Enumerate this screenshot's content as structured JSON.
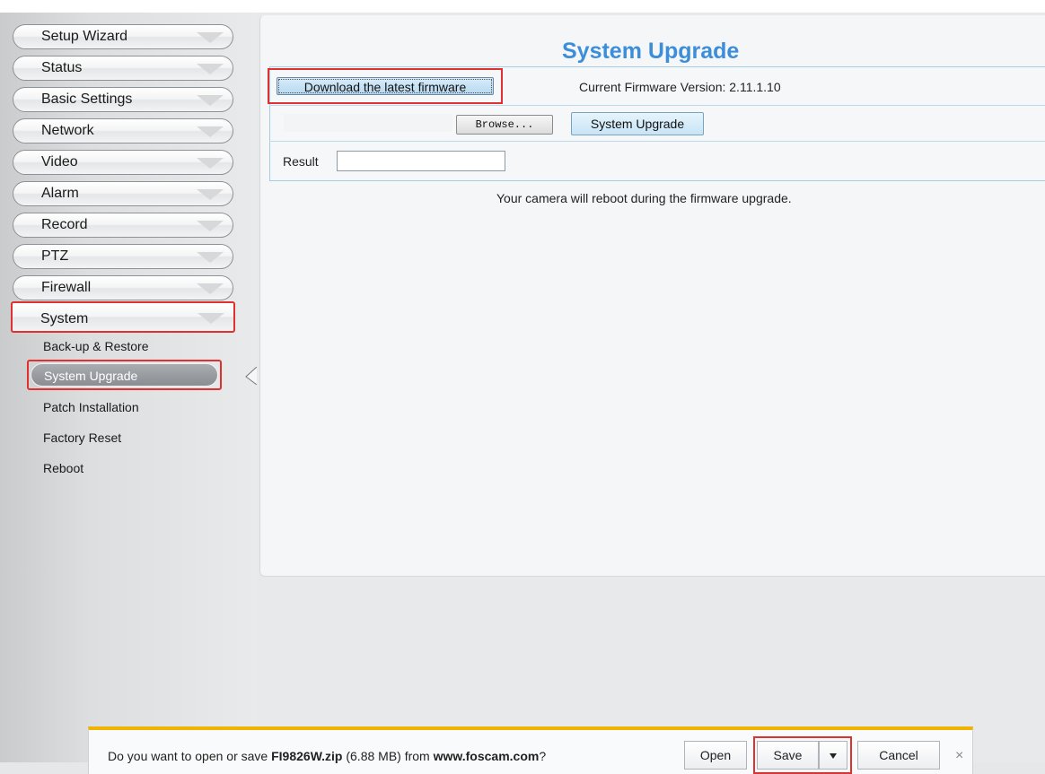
{
  "sidebar": {
    "items": [
      {
        "label": "Setup Wizard"
      },
      {
        "label": "Status"
      },
      {
        "label": "Basic Settings"
      },
      {
        "label": "Network"
      },
      {
        "label": "Video"
      },
      {
        "label": "Alarm"
      },
      {
        "label": "Record"
      },
      {
        "label": "PTZ"
      },
      {
        "label": "Firewall"
      },
      {
        "label": "System"
      }
    ],
    "sub_items": [
      {
        "label": "Back-up & Restore"
      },
      {
        "label": "System Upgrade"
      },
      {
        "label": "Patch Installation"
      },
      {
        "label": "Factory Reset"
      },
      {
        "label": "Reboot"
      }
    ]
  },
  "main": {
    "title": "System Upgrade",
    "download_button": "Download the latest firmware",
    "firmware_version": "Current Firmware Version: 2.11.1.10",
    "browse_button": "Browse...",
    "upgrade_button": "System Upgrade",
    "result_label": "Result",
    "note": "Your camera will reboot during the firmware upgrade."
  },
  "download_bar": {
    "prompt_prefix": "Do you want to open or save ",
    "file_name": "FI9826W.zip",
    "file_size": " (6.88 MB) from ",
    "source": "www.foscam.com",
    "prompt_suffix": "?",
    "open_button": "Open",
    "save_button": "Save",
    "cancel_button": "Cancel",
    "close_glyph": "×"
  }
}
